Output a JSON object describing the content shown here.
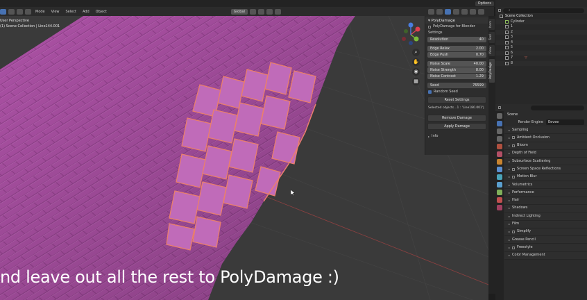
{
  "topbar": {
    "options_label": "Options"
  },
  "header": {
    "mode_label": "Mode",
    "menus": [
      "View",
      "Select",
      "Add",
      "Object"
    ],
    "transform_orientation": "Global"
  },
  "viewport_info": {
    "perspective": "User Perspective",
    "collection": "(1) Scene Collection | Line144.001"
  },
  "subtitle": "nd leave out all the rest to PolyDamage :)",
  "navigation": {
    "gizmo_axes": [
      "X",
      "Y",
      "Z"
    ],
    "icons": [
      "zoom-icon",
      "hand-icon",
      "camera-icon",
      "grid-icon"
    ]
  },
  "npanel": {
    "title": "PolyDamage",
    "subtitle": "PolyDamage for Blender",
    "settings_label": "Settings",
    "resolution": {
      "label": "Resolution",
      "value": "40"
    },
    "edge_relax": {
      "label": "Edge Relax",
      "value": "2.00"
    },
    "edge_push": {
      "label": "Edge Push",
      "value": "0.70"
    },
    "noise_scale": {
      "label": "Noise Scale",
      "value": "40.00"
    },
    "noise_strength": {
      "label": "Noise Strength",
      "value": "8.00"
    },
    "noise_contrast": {
      "label": "Noise Contrast",
      "value": "1.29"
    },
    "seed": {
      "label": "Seed",
      "value": "76599"
    },
    "random_seed_label": "Random Seed",
    "reset_label": "Reset Settings",
    "selected_text": "Selected objects...1 : 'Line180.001'|",
    "remove_label": "Remove Damage",
    "apply_label": "Apply Damage",
    "info_label": "Info"
  },
  "ntabs": [
    "Item",
    "Tool",
    "View",
    "PolyDesign"
  ],
  "outliner": {
    "root": "Scene Collection",
    "rows": [
      "Cylinder",
      "1",
      "2",
      "3",
      "4",
      "5",
      "6",
      "7",
      "8"
    ]
  },
  "properties": {
    "scene_label": "Scene",
    "render_engine_label": "Render Engine",
    "render_engine_value": "Eevee",
    "sections": [
      {
        "label": "Sampling",
        "checkbox": false
      },
      {
        "label": "Ambient Occlusion",
        "checkbox": true
      },
      {
        "label": "Bloom",
        "checkbox": true
      },
      {
        "label": "Depth of Field",
        "checkbox": false
      },
      {
        "label": "Subsurface Scattering",
        "checkbox": false
      },
      {
        "label": "Screen Space Reflections",
        "checkbox": true
      },
      {
        "label": "Motion Blur",
        "checkbox": true
      },
      {
        "label": "Volumetrics",
        "checkbox": false
      },
      {
        "label": "Performance",
        "checkbox": false
      },
      {
        "label": "Hair",
        "checkbox": false
      },
      {
        "label": "Shadows",
        "checkbox": false
      },
      {
        "label": "Indirect Lighting",
        "checkbox": false
      },
      {
        "label": "Film",
        "checkbox": false
      },
      {
        "label": "Simplify",
        "checkbox": true
      },
      {
        "label": "Grease Pencil",
        "checkbox": false
      },
      {
        "label": "Freestyle",
        "checkbox": true
      },
      {
        "label": "Color Management",
        "checkbox": false
      }
    ]
  },
  "colors": {
    "mesh": "#b455ad",
    "selected": "#e8826a",
    "accent": "#4772b3"
  }
}
